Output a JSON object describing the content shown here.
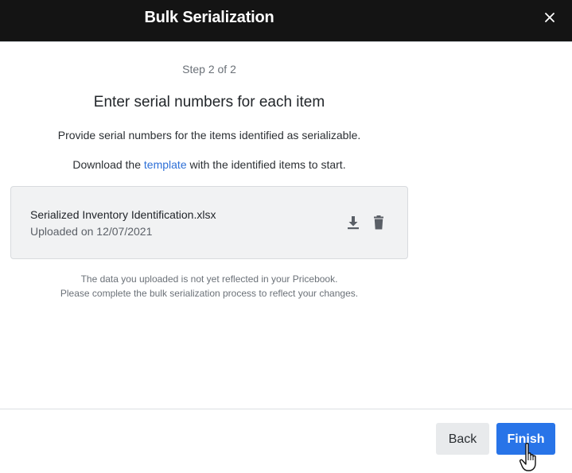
{
  "dialog": {
    "title": "Bulk Serialization",
    "close_icon": "close-icon"
  },
  "content": {
    "step": "Step 2 of 2",
    "heading": "Enter serial numbers for each item",
    "description": "Provide serial numbers for the items identified as serializable.",
    "download_prefix": "Download the ",
    "download_link": "template",
    "download_suffix": " with the identified items to start."
  },
  "file": {
    "name": "Serialized Inventory Identification.xlsx",
    "uploaded": "Uploaded on 12/07/2021",
    "download_icon": "download-icon",
    "delete_icon": "trash-icon"
  },
  "notice": {
    "line1": "The data you uploaded is not yet reflected in your Pricebook.",
    "line2": "Please complete the bulk serialization process to reflect your changes."
  },
  "footer": {
    "back_label": "Back",
    "finish_label": "Finish"
  },
  "colors": {
    "header_bg": "#141414",
    "primary": "#2874e8",
    "link": "#2d6fd6",
    "card_bg": "#f1f2f3"
  }
}
